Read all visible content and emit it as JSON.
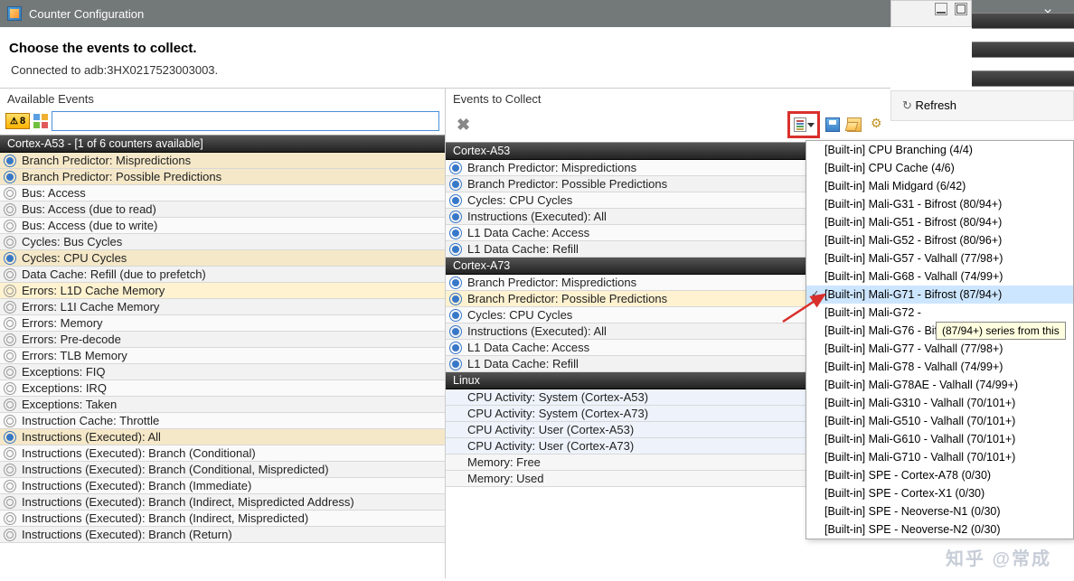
{
  "window": {
    "title": "Counter Configuration"
  },
  "header": {
    "heading": "Choose the events to collect.",
    "connected": "Connected to adb:3HX0217523003003."
  },
  "left": {
    "title": "Available Events",
    "warn_count": "8",
    "search_placeholder": "",
    "groups": [
      {
        "title": "Cortex-A53 - [1 of 6 counters available]",
        "items": [
          {
            "label": "Branch Predictor: Mispredictions",
            "sel": true
          },
          {
            "label": "Branch Predictor: Possible Predictions",
            "sel": true
          },
          {
            "label": "Bus: Access"
          },
          {
            "label": "Bus: Access (due to read)"
          },
          {
            "label": "Bus: Access (due to write)"
          },
          {
            "label": "Cycles: Bus Cycles"
          },
          {
            "label": "Cycles: CPU Cycles",
            "sel": true
          },
          {
            "label": "Data Cache: Refill (due to prefetch)"
          },
          {
            "label": "Errors: L1D Cache Memory",
            "hl": true
          },
          {
            "label": "Errors: L1I Cache Memory"
          },
          {
            "label": "Errors: Memory"
          },
          {
            "label": "Errors: Pre-decode"
          },
          {
            "label": "Errors: TLB Memory"
          },
          {
            "label": "Exceptions: FIQ"
          },
          {
            "label": "Exceptions: IRQ"
          },
          {
            "label": "Exceptions: Taken"
          },
          {
            "label": "Instruction Cache: Throttle"
          },
          {
            "label": "Instructions (Executed): All",
            "sel": true
          },
          {
            "label": "Instructions (Executed): Branch (Conditional)"
          },
          {
            "label": "Instructions (Executed): Branch (Conditional, Mispredicted)"
          },
          {
            "label": "Instructions (Executed): Branch (Immediate)"
          },
          {
            "label": "Instructions (Executed): Branch (Indirect, Mispredicted Address)"
          },
          {
            "label": "Instructions (Executed): Branch (Indirect, Mispredicted)"
          },
          {
            "label": "Instructions (Executed): Branch (Return)"
          }
        ]
      }
    ]
  },
  "right": {
    "title": "Events to Collect",
    "groups": [
      {
        "title": "Cortex-A53",
        "items": [
          {
            "label": "Branch Predictor: Mispredictions"
          },
          {
            "label": "Branch Predictor: Possible Predictions"
          },
          {
            "label": "Cycles: CPU Cycles"
          },
          {
            "label": "Instructions (Executed): All"
          },
          {
            "label": "L1 Data Cache: Access"
          },
          {
            "label": "L1 Data Cache: Refill"
          }
        ]
      },
      {
        "title": "Cortex-A73",
        "items": [
          {
            "label": "Branch Predictor: Mispredictions"
          },
          {
            "label": "Branch Predictor: Possible Predictions",
            "hl": true
          },
          {
            "label": "Cycles: CPU Cycles"
          },
          {
            "label": "Instructions (Executed): All"
          },
          {
            "label": "L1 Data Cache: Access"
          },
          {
            "label": "L1 Data Cache: Refill"
          }
        ]
      },
      {
        "title": "Linux",
        "plain": true,
        "items": [
          {
            "label": "CPU Activity: System (Cortex-A53)"
          },
          {
            "label": "CPU Activity: System (Cortex-A73)"
          },
          {
            "label": "CPU Activity: User (Cortex-A53)"
          },
          {
            "label": "CPU Activity: User (Cortex-A73)"
          },
          {
            "label": "Memory: Free",
            "free": true
          },
          {
            "label": "Memory: Used",
            "free": true
          }
        ]
      }
    ]
  },
  "refresh": {
    "label": "Refresh"
  },
  "dropdown": {
    "items": [
      "[Built-in] CPU Branching (4/4)",
      "[Built-in] CPU Cache (4/6)",
      "[Built-in] Mali Midgard (6/42)",
      "[Built-in] Mali-G31 - Bifrost (80/94+)",
      "[Built-in] Mali-G51 - Bifrost (80/94+)",
      "[Built-in] Mali-G52 - Bifrost (80/96+)",
      "[Built-in] Mali-G57 - Valhall (77/98+)",
      "[Built-in] Mali-G68 - Valhall (74/99+)",
      "[Built-in] Mali-G71 - Bifrost (87/94+)",
      "[Built-in] Mali-G72 - ",
      "[Built-in] Mali-G76 - Bifrost (80/96+)",
      "[Built-in] Mali-G77 - Valhall (77/98+)",
      "[Built-in] Mali-G78 - Valhall (74/99+)",
      "[Built-in] Mali-G78AE - Valhall (74/99+)",
      "[Built-in] Mali-G310 - Valhall (70/101+)",
      "[Built-in] Mali-G510 - Valhall (70/101+)",
      "[Built-in] Mali-G610 - Valhall (70/101+)",
      "[Built-in] Mali-G710 - Valhall (70/101+)",
      "[Built-in] SPE - Cortex-A78 (0/30)",
      "[Built-in] SPE - Cortex-X1 (0/30)",
      "[Built-in] SPE - Neoverse-N1 (0/30)",
      "[Built-in] SPE - Neoverse-N2 (0/30)"
    ],
    "selected_index": 8
  },
  "tooltip": "(87/94+) series from this",
  "watermark": "知乎 @常成"
}
